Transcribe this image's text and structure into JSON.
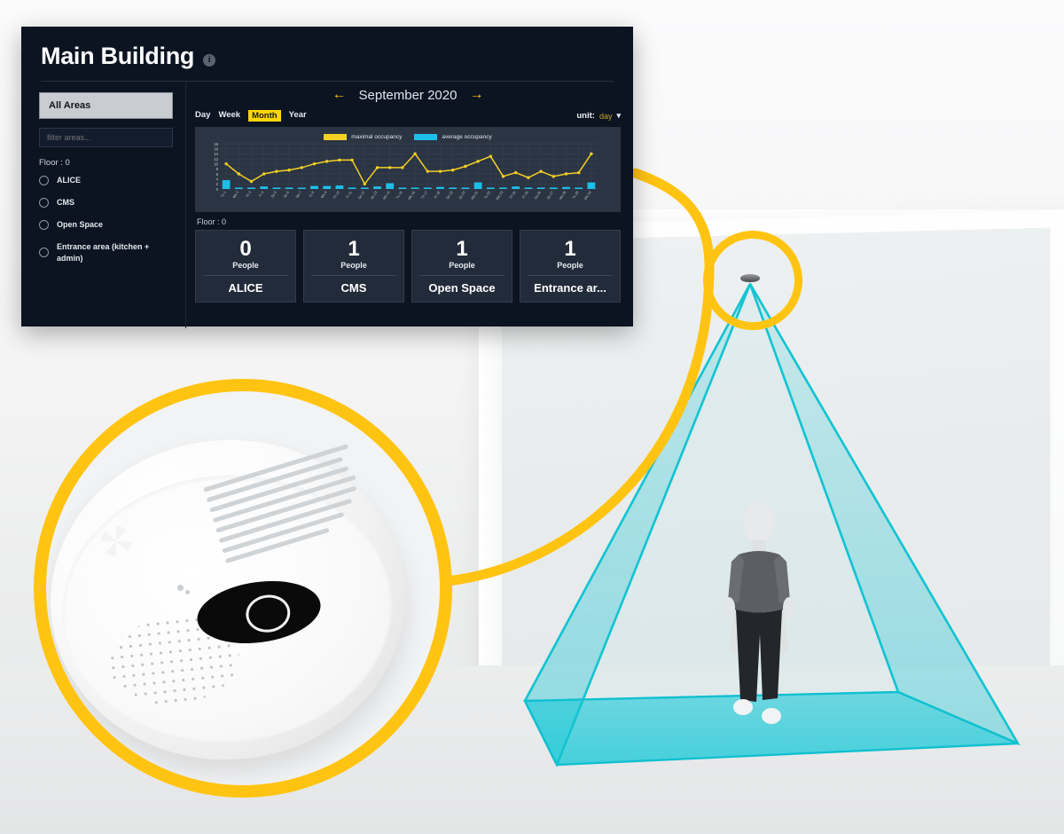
{
  "dashboard": {
    "title": "Main Building",
    "info_icon": "info-icon",
    "sidebar": {
      "all_areas_label": "All Areas",
      "filter_placeholder": "filter areas...",
      "floor_label": "Floor : 0",
      "areas": [
        {
          "label": "ALICE",
          "selected": false
        },
        {
          "label": "CMS",
          "selected": false
        },
        {
          "label": "Open Space",
          "selected": false
        },
        {
          "label": "Entrance area (kitchen + admin)",
          "selected": false
        }
      ]
    },
    "period": {
      "prev_arrow": "←",
      "label": "September 2020",
      "next_arrow": "→",
      "ranges": [
        "Day",
        "Week",
        "Month",
        "Year"
      ],
      "active_range": "Month",
      "unit_label": "unit:",
      "unit_value": "day",
      "unit_caret": "chevron-down-icon"
    },
    "floor_section_label": "Floor : 0",
    "cards": [
      {
        "count": "0",
        "unit": "People",
        "name": "ALICE"
      },
      {
        "count": "1",
        "unit": "People",
        "name": "CMS"
      },
      {
        "count": "1",
        "unit": "People",
        "name": "Open Space"
      },
      {
        "count": "1",
        "unit": "People",
        "name": "Entrance ar..."
      }
    ]
  },
  "chart_data": {
    "type": "line",
    "title": "September 2020",
    "xlabel": "",
    "ylabel": "",
    "ylim": [
      0,
      18
    ],
    "yticks": [
      18,
      16,
      14,
      12,
      10,
      8,
      6,
      4,
      2,
      0
    ],
    "grid": true,
    "legend_position": "top-center",
    "categories": [
      "Tu 1",
      "We 2",
      "Th 3",
      "Fr 4",
      "Sa 5",
      "Su 6",
      "Mo 7",
      "Tu 8",
      "We 9",
      "Th 10",
      "Fr 11",
      "Sa 12",
      "Su 13",
      "Mo 14",
      "Tu 15",
      "We 16",
      "Th 17",
      "Fr 18",
      "Sa 19",
      "Su 20",
      "Mo 21",
      "Tu 22",
      "We 23",
      "Th 24",
      "Fr 25",
      "Sa 26",
      "Su 27",
      "Mo 28",
      "Tu 29",
      "We 30"
    ],
    "series": [
      {
        "name": "maximal occupancy",
        "type": "line",
        "color": "#f2d024",
        "values": [
          10,
          6,
          3,
          6,
          7,
          7.5,
          8.5,
          10,
          11,
          11.5,
          11.5,
          2,
          8.5,
          8.5,
          8.5,
          14,
          7,
          7,
          7.5,
          9,
          11,
          13,
          5,
          6.5,
          4.5,
          7,
          5,
          6,
          6.5,
          14
        ]
      },
      {
        "name": "average occupancy",
        "type": "bar",
        "color": "#1dbfe8",
        "values": [
          3.5,
          0.5,
          0.3,
          1.0,
          0.3,
          0.3,
          0.3,
          1.2,
          1.2,
          1.4,
          0.3,
          0.3,
          1.0,
          2.3,
          0.3,
          0.3,
          0.5,
          0.8,
          0.3,
          0.3,
          2.6,
          0.3,
          0.3,
          1.0,
          0.3,
          0.3,
          0.3,
          0.8,
          0.3,
          2.6
        ]
      }
    ]
  },
  "scene": {
    "sensor": "ceiling-sensor-puck",
    "detector_photo": "smoke-detector-closeup",
    "detection_cone": "cyan-detection-pyramid",
    "person": "person-figure",
    "callout_color": "#ffc412",
    "cone_color": "#17c6d4"
  }
}
